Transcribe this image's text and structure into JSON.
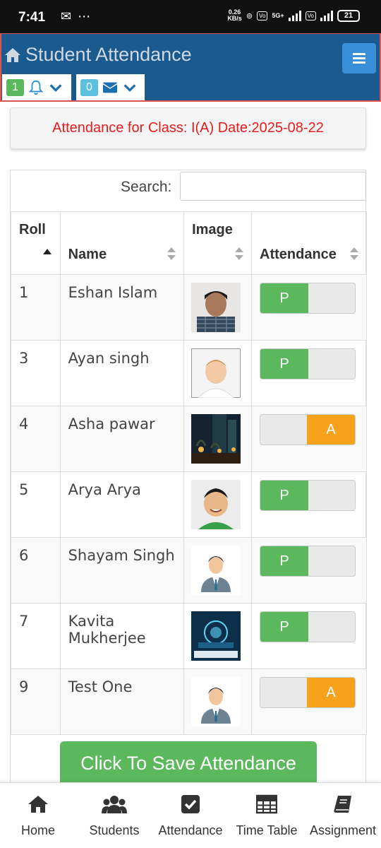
{
  "status_bar": {
    "time": "7:41",
    "left_icons": [
      "gmail-icon",
      "more-icon"
    ],
    "speed_value": "0.26",
    "speed_unit": "KB/s",
    "network_1": "5G+",
    "battery": "21"
  },
  "header": {
    "title": "Student Attendance",
    "notification_count": "1",
    "message_count": "0"
  },
  "class_info": "Attendance for Class: I(A) Date:2025-08-22",
  "search": {
    "label": "Search:",
    "value": ""
  },
  "table": {
    "headers": {
      "roll": "Roll",
      "name": "Name",
      "image": "Image",
      "attendance": "Attendance"
    },
    "rows": [
      {
        "roll": "1",
        "name": "Eshan Islam",
        "status": "P"
      },
      {
        "roll": "3",
        "name": "Ayan singh",
        "status": "P"
      },
      {
        "roll": "4",
        "name": "Asha pawar",
        "status": "A"
      },
      {
        "roll": "5",
        "name": "Arya Arya",
        "status": "P"
      },
      {
        "roll": "6",
        "name": "Shayam Singh",
        "status": "P"
      },
      {
        "roll": "7",
        "name": "Kavita Mukherjee",
        "status": "P"
      },
      {
        "roll": "9",
        "name": "Test One",
        "status": "A"
      }
    ]
  },
  "save_button": "Click To Save Attendance",
  "bottom_nav": {
    "home": "Home",
    "students": "Students",
    "attendance": "Attendance",
    "timetable": "Time Table",
    "assignment": "Assignment"
  },
  "colors": {
    "header_bg": "#1a5a8e",
    "present": "#5cb85c",
    "absent": "#f6a21b",
    "class_text": "#e81c1c"
  }
}
